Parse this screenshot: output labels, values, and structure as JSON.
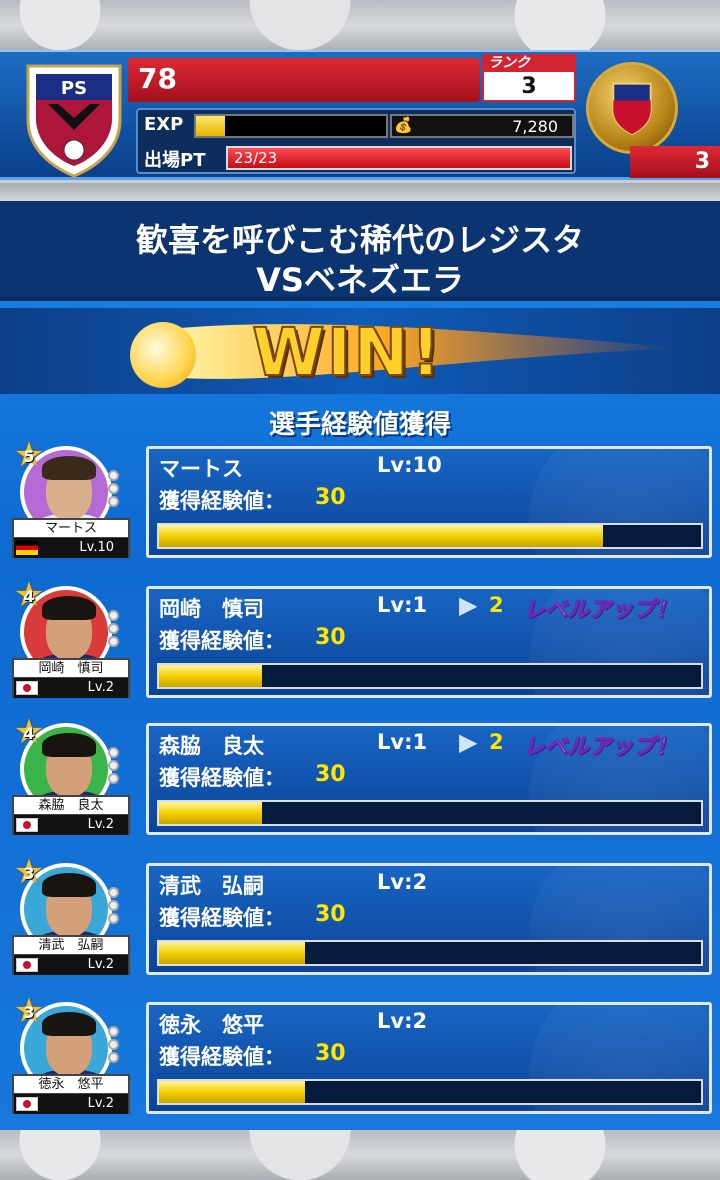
{
  "header": {
    "player_level": "78",
    "rank_label": "ランク",
    "rank_value": "3",
    "exp_label": "EXP",
    "exp_fill": 0.15,
    "money": "7,280",
    "pt_label": "出場PT",
    "pt_value": "23/23",
    "pt_fill": 1.0,
    "coin_count": "3",
    "emblem_text": "PS"
  },
  "match": {
    "title_line1": "歓喜を呼びこむ稀代のレジスタ",
    "title_line2": "VSベネズエラ",
    "result": "WIN!",
    "subheading": "選手経験値獲得"
  },
  "players": [
    {
      "name": "マートス",
      "lv": "Lv:10",
      "lv_to": "",
      "lv_up": "",
      "exp_label": "獲得経験値：",
      "exp_value": "30",
      "exp_fill": 0.82,
      "stars": "5",
      "plate_name": "マートス",
      "plate_lv": "Lv.10",
      "flag": "de",
      "ring_color": "#b56ad6",
      "shirt": "#e8e8e8",
      "hair": "#3a2a1a",
      "skin": "#d9b08c"
    },
    {
      "name": "岡崎　慎司",
      "lv": "Lv:1",
      "lv_to": "2",
      "lv_up": "レベルアップ！",
      "exp_label": "獲得経験値：",
      "exp_value": "30",
      "exp_fill": 0.19,
      "stars": "4",
      "plate_name": "岡崎　慎司",
      "plate_lv": "Lv.2",
      "flag": "jp",
      "ring_color": "#d93a3a",
      "shirt": "#1b2a6b",
      "hair": "#1a1410",
      "skin": "#d4a07a"
    },
    {
      "name": "森脇　良太",
      "lv": "Lv:1",
      "lv_to": "2",
      "lv_up": "レベルアップ！",
      "exp_label": "獲得経験値：",
      "exp_value": "30",
      "exp_fill": 0.19,
      "stars": "4",
      "plate_name": "森脇　良太",
      "plate_lv": "Lv.2",
      "flag": "jp",
      "ring_color": "#39b54a",
      "shirt": "#1b2a6b",
      "hair": "#1a1410",
      "skin": "#d4a07a"
    },
    {
      "name": "清武　弘嗣",
      "lv": "Lv:2",
      "lv_to": "",
      "lv_up": "",
      "exp_label": "獲得経験値：",
      "exp_value": "30",
      "exp_fill": 0.27,
      "stars": "3",
      "plate_name": "清武　弘嗣",
      "plate_lv": "Lv.2",
      "flag": "jp",
      "ring_color": "#3aa7d9",
      "shirt": "#1b2a6b",
      "hair": "#1a1410",
      "skin": "#d4a07a"
    },
    {
      "name": "徳永　悠平",
      "lv": "Lv:2",
      "lv_to": "",
      "lv_up": "",
      "exp_label": "獲得経験値：",
      "exp_value": "30",
      "exp_fill": 0.27,
      "stars": "3",
      "plate_name": "徳永　悠平",
      "plate_lv": "Lv.2",
      "flag": "jp",
      "ring_color": "#3aa7d9",
      "shirt": "#1b2a6b",
      "hair": "#1a1410",
      "skin": "#d4a07a"
    }
  ]
}
